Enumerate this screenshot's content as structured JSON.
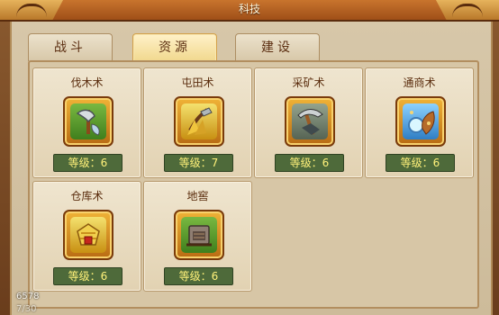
{
  "window": {
    "title": "科技"
  },
  "tabs": [
    {
      "label": "战斗",
      "active": false
    },
    {
      "label": "资源",
      "active": true
    },
    {
      "label": "建设",
      "active": false
    }
  ],
  "skills": [
    {
      "name": "伐木术",
      "level": "等级：6",
      "icon": "axe-icon"
    },
    {
      "name": "屯田术",
      "level": "等级：7",
      "icon": "farming-icon"
    },
    {
      "name": "采矿术",
      "level": "等级：6",
      "icon": "mining-icon"
    },
    {
      "name": "通商术",
      "level": "等级：6",
      "icon": "trade-icon"
    },
    {
      "name": "仓库术",
      "level": "等级：6",
      "icon": "storehouse-icon"
    },
    {
      "name": "地窖",
      "level": "等级：6",
      "icon": "cellar-icon"
    }
  ],
  "overlay": {
    "code": "6578",
    "sub": "7/30"
  },
  "colors": {
    "title_bar": "#b86422",
    "panel": "#d7c7a9",
    "active_tab": "#f3d98f",
    "level_bar": "#4e6a3a",
    "level_text": "#fff17a"
  }
}
